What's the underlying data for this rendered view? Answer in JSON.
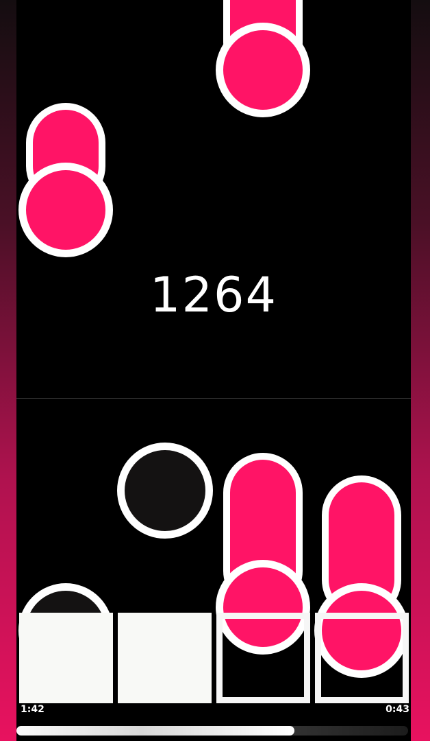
{
  "game": {
    "score": "1264",
    "time_elapsed": "1:42",
    "time_remaining": "0:43",
    "progress": 0.71,
    "lanes": 4
  },
  "colors": {
    "note": "#ff1466",
    "note_border": "#ffffff",
    "pad": "#f8f9f6",
    "empty_note": "#141212",
    "side_gradient_bottom": "#e8125f"
  }
}
